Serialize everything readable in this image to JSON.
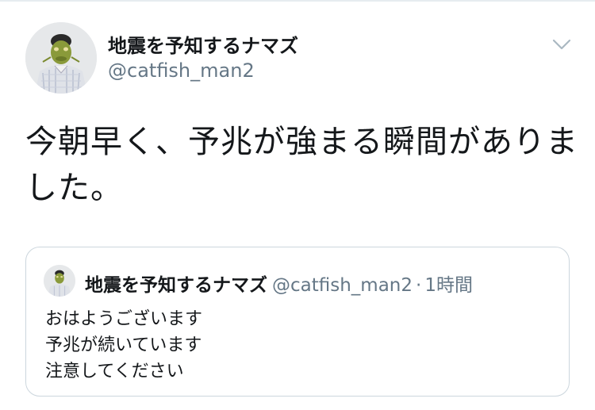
{
  "tweet": {
    "author_name": "地震を予知するナマズ",
    "author_handle": "@catfish_man2",
    "avatar_icon": "catfish-mask-man-avatar",
    "menu_icon": "chevron-down-icon",
    "text": "今朝早く、予兆が強まる瞬間がありました。"
  },
  "quoted_tweet": {
    "author_name": "地震を予知するナマズ",
    "author_handle": "@catfish_man2",
    "time": "1時間",
    "lines": [
      "おはようございます",
      "予兆が続いています",
      "注意してください"
    ]
  },
  "colors": {
    "text": "#14171a",
    "secondary": "#657786",
    "border": "#ccd6dd"
  }
}
